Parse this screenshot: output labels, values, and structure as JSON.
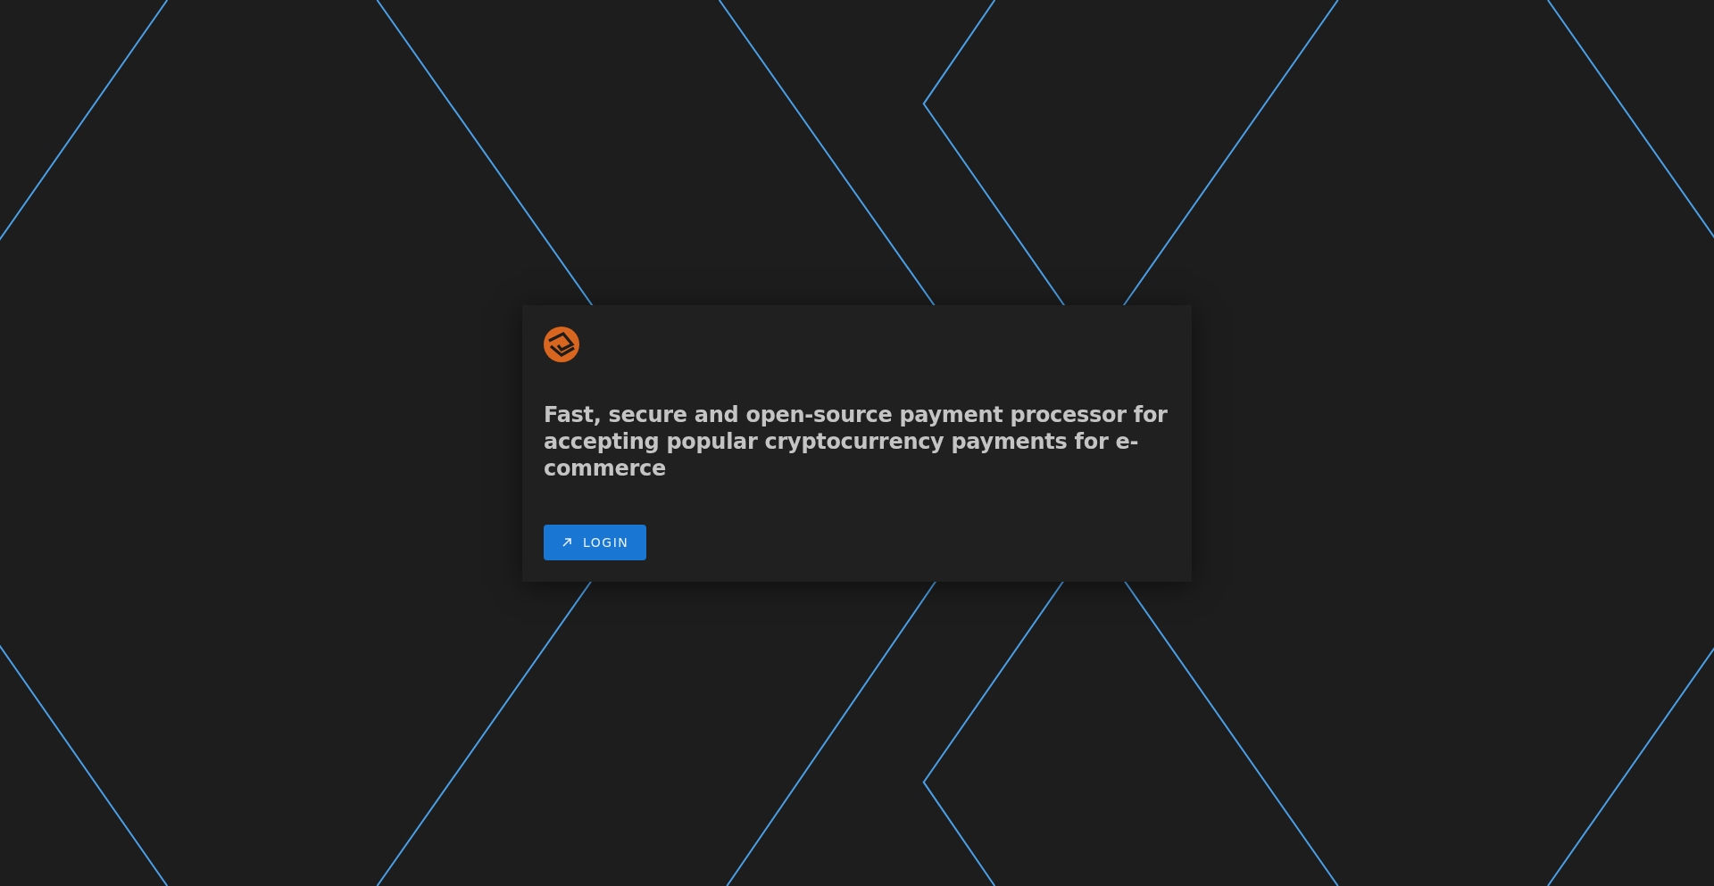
{
  "card": {
    "tagline": "Fast, secure and open-source payment processor for accepting popular cryptocurrency payments for e-commerce",
    "button": {
      "label": "LOGIN"
    }
  }
}
